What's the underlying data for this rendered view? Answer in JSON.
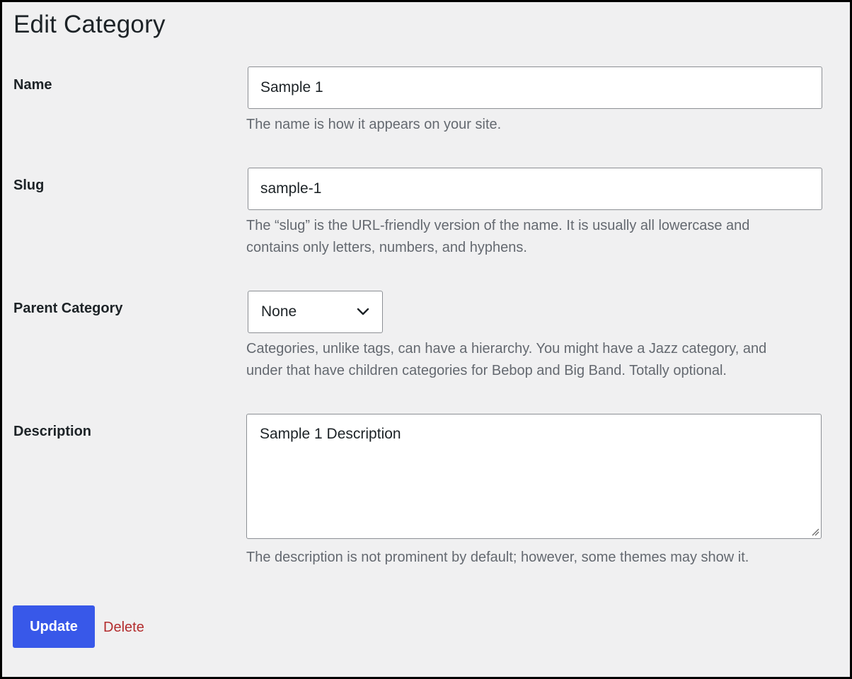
{
  "page": {
    "title": "Edit Category"
  },
  "fields": {
    "name": {
      "label": "Name",
      "value": "Sample 1",
      "help": "The name is how it appears on your site."
    },
    "slug": {
      "label": "Slug",
      "value": "sample-1",
      "help_line1": "The “slug” is the URL-friendly version of the name. It is usually all lowercase and",
      "help_line2": "contains only letters, numbers, and hyphens."
    },
    "parent": {
      "label": "Parent Category",
      "selected": "None",
      "help_line1": "Categories, unlike tags, can have a hierarchy. You might have a Jazz category, and",
      "help_line2": "under that have children categories for Bebop and Big Band. Totally optional."
    },
    "description": {
      "label": "Description",
      "value": "Sample 1 Description",
      "help": "The description is not prominent by default; however, some themes may show it."
    }
  },
  "actions": {
    "update_label": "Update",
    "delete_label": "Delete"
  },
  "colors": {
    "background": "#f0f0f1",
    "primary": "#3858e9",
    "delete": "#b32d2e",
    "help_text": "#646970",
    "text": "#1d2327"
  },
  "icons": {
    "select_arrow": "chevron-down-icon",
    "textarea_resize": "resize-handle-icon"
  }
}
